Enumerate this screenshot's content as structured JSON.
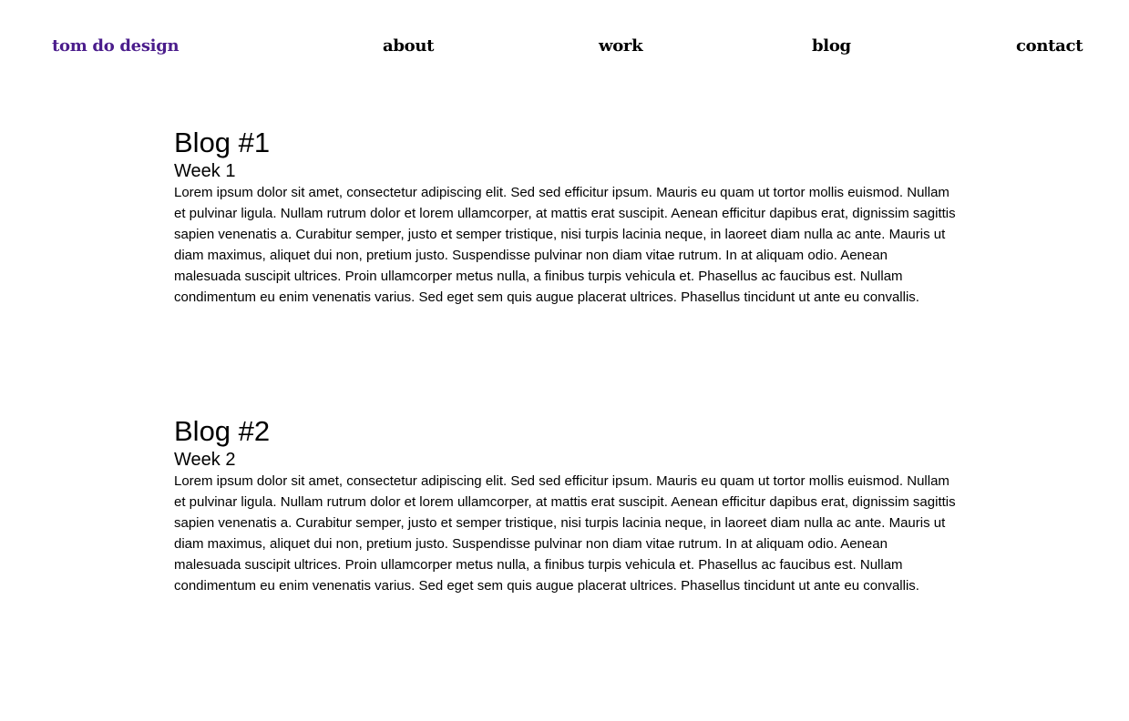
{
  "nav": {
    "logo": "tom do design",
    "logo_color": "#4b1d8c",
    "links": [
      "about",
      "work",
      "blog",
      "contact"
    ]
  },
  "posts": [
    {
      "title": "Blog #1",
      "subtitle": "Week 1",
      "body": "Lorem ipsum dolor sit amet, consectetur adipiscing elit. Sed sed efficitur ipsum. Mauris eu quam ut tortor mollis euismod. Nullam et pulvinar ligula. Nullam rutrum dolor et lorem ullamcorper, at mattis erat suscipit. Aenean efficitur dapibus erat, dignissim sagittis sapien venenatis a. Curabitur semper, justo et semper tristique, nisi turpis lacinia neque, in laoreet diam nulla ac ante. Mauris ut diam maximus, aliquet dui non, pretium justo. Suspendisse pulvinar non diam vitae rutrum. In at aliquam odio. Aenean malesuada suscipit ultrices. Proin ullamcorper metus nulla, a finibus turpis vehicula et. Phasellus ac faucibus est. Nullam condimentum eu enim venenatis varius. Sed eget sem quis augue placerat ultrices. Phasellus tincidunt ut ante eu convallis."
    },
    {
      "title": "Blog #2",
      "subtitle": "Week 2",
      "body": "Lorem ipsum dolor sit amet, consectetur adipiscing elit. Sed sed efficitur ipsum. Mauris eu quam ut tortor mollis euismod. Nullam et pulvinar ligula. Nullam rutrum dolor et lorem ullamcorper, at mattis erat suscipit. Aenean efficitur dapibus erat, dignissim sagittis sapien venenatis a. Curabitur semper, justo et semper tristique, nisi turpis lacinia neque, in laoreet diam nulla ac ante. Mauris ut diam maximus, aliquet dui non, pretium justo. Suspendisse pulvinar non diam vitae rutrum. In at aliquam odio. Aenean malesuada suscipit ultrices. Proin ullamcorper metus nulla, a finibus turpis vehicula et. Phasellus ac faucibus est. Nullam condimentum eu enim venenatis varius. Sed eget sem quis augue placerat ultrices. Phasellus tincidunt ut ante eu convallis."
    }
  ]
}
